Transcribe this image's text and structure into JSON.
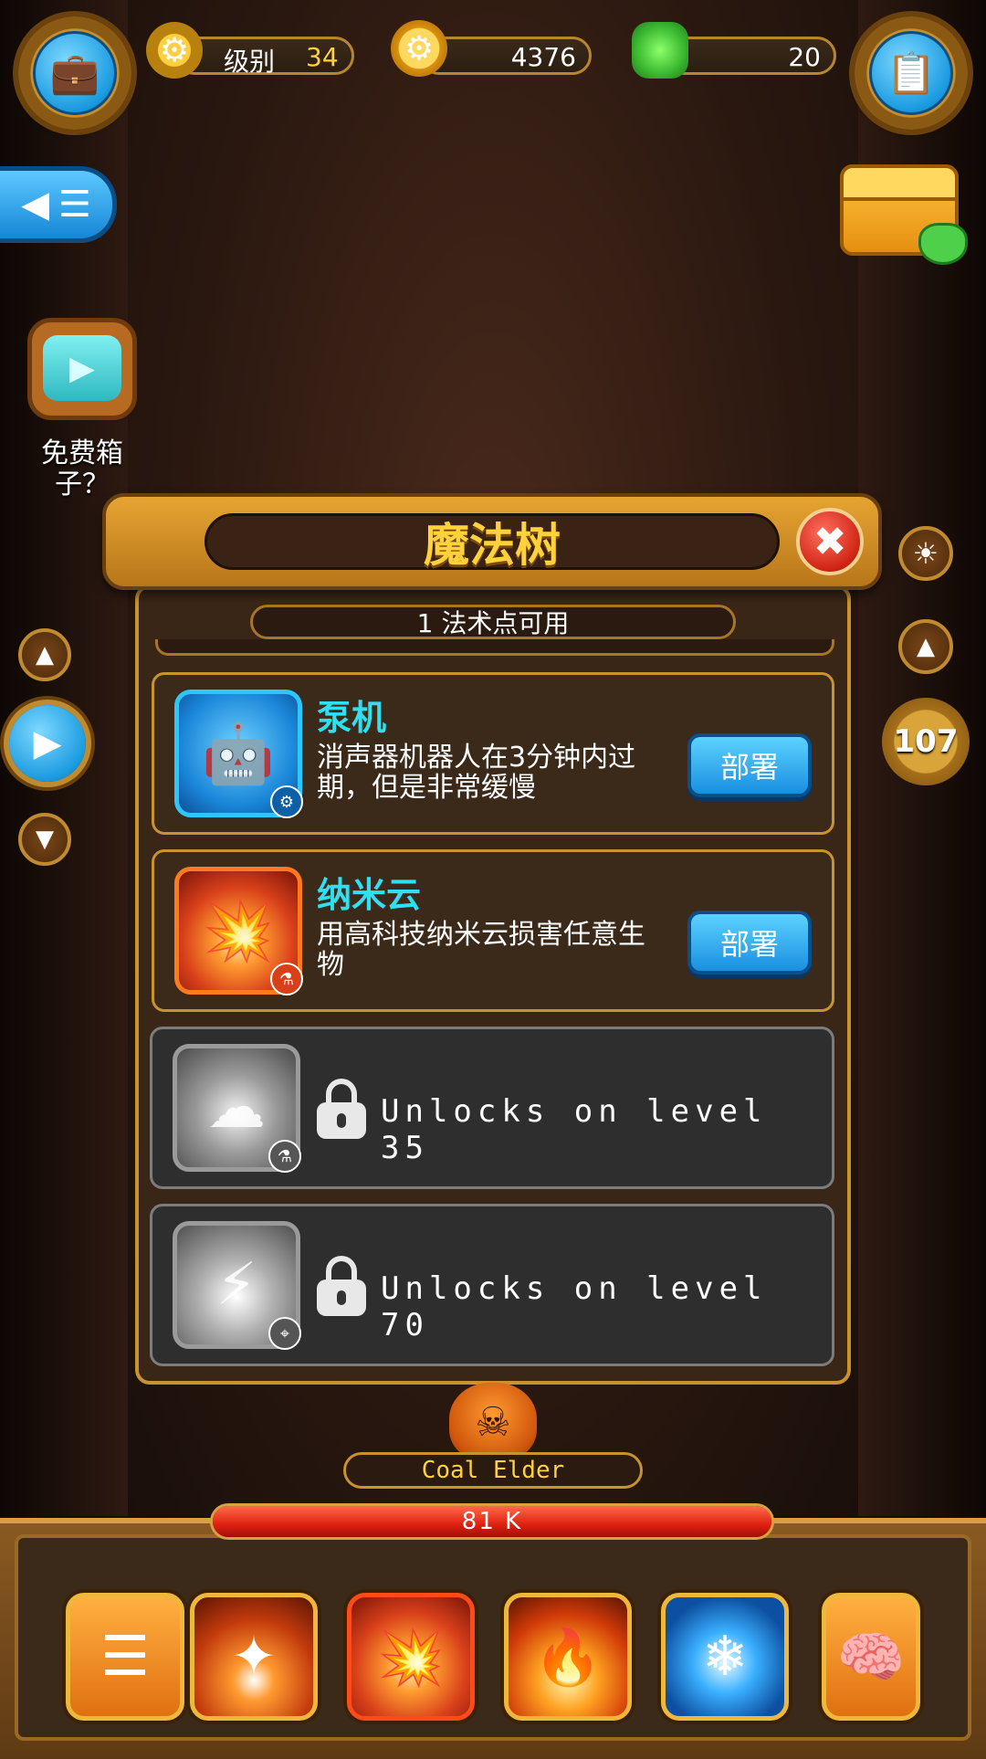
{
  "hud": {
    "level_label": "级别",
    "level_value": "34",
    "coins": "4376",
    "gems": "20"
  },
  "left": {
    "free_box_label": "免费箱子？"
  },
  "right": {
    "counter": "107"
  },
  "dialog": {
    "title": "魔法树",
    "points_available": "1 法术点可用",
    "spells": [
      {
        "name": "泵机",
        "description": "消声器机器人在3分钟内过期，但是非常缓慢",
        "action": "部署",
        "icon": "robot-icon",
        "locked": false
      },
      {
        "name": "纳米云",
        "description": "用高科技纳米云损害任意生物",
        "action": "部署",
        "icon": "nano-cloud-icon",
        "locked": false
      },
      {
        "icon": "smoke-cloud-icon",
        "locked": true,
        "unlock_text": "Unlocks on level 35"
      },
      {
        "icon": "lightning-icon",
        "locked": true,
        "unlock_text": "Unlocks on level 70"
      }
    ]
  },
  "boss": {
    "name": "Coal Elder",
    "hp_text": "81 K",
    "hp_fraction": 1.0
  },
  "bottom_bar": {
    "slots": [
      "menu-list-icon",
      "beam-spell-icon",
      "nano-cloud-icon",
      "fire-spell-icon",
      "ice-spell-icon",
      "brain-icon"
    ]
  },
  "colors": {
    "accent_gold": "#ffd23c",
    "spell_name": "#2ee0f0",
    "button_blue": "#1a8fe0",
    "hp_red": "#e02010"
  }
}
